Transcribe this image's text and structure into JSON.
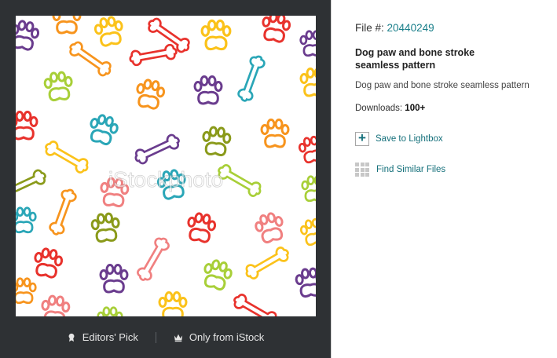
{
  "image": {
    "watermark": "iStockphoto",
    "alt": "Dog paw and bone stroke seamless pattern"
  },
  "bottom_bar": {
    "editors_pick": "Editors' Pick",
    "only_from": "Only from iStock"
  },
  "details": {
    "file_label": "File #:",
    "file_number": "20440249",
    "title": "Dog paw and bone stroke seamless pattern",
    "description": "Dog paw and bone stroke seamless pattern",
    "downloads_label": "Downloads:",
    "downloads_value": "100+"
  },
  "actions": {
    "save_lightbox": "Save to Lightbox",
    "find_similar": "Find Similar Files"
  },
  "colors": {
    "link": "#1a7f8a",
    "dark_panel": "#2e3134",
    "pattern_red": "#e8322c",
    "pattern_orange": "#f7941d",
    "pattern_yellow": "#fbc21a",
    "pattern_green": "#a8cf38",
    "pattern_olive": "#8a9a1a",
    "pattern_teal": "#2aa6b7",
    "pattern_purple": "#6a3c8e",
    "pattern_pink": "#f08080"
  }
}
